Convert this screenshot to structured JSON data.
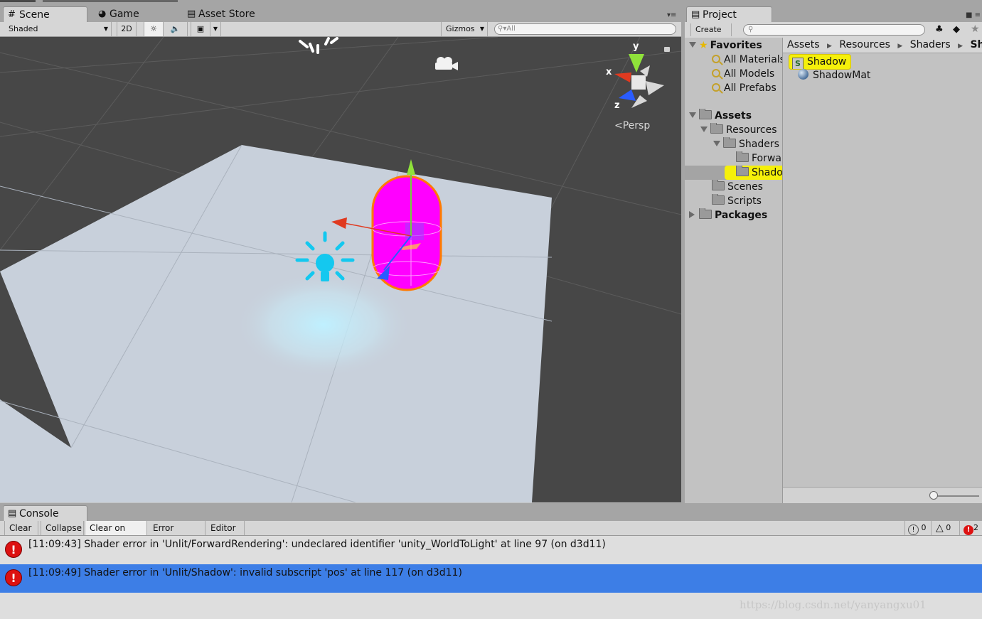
{
  "scene_panel": {
    "tabs": [
      {
        "label": "Scene",
        "icon": "grid-icon"
      },
      {
        "label": "Game",
        "icon": "pacman-icon"
      },
      {
        "label": "Asset Store",
        "icon": "store-icon"
      }
    ],
    "toolbar": {
      "shading_mode": "Shaded",
      "mode_2d": "2D",
      "gizmos": "Gizmos",
      "search_placeholder": "All"
    },
    "view": {
      "axis_labels": {
        "x": "x",
        "y": "y",
        "z": "z"
      },
      "projection": "Persp",
      "colors": {
        "background": "#474747",
        "plane": "#c8d0db",
        "capsule": "#ff00ff",
        "light": "#14c8ef"
      }
    }
  },
  "project_panel": {
    "tab": "Project",
    "create": "Create",
    "favorites": {
      "label": "Favorites",
      "items": [
        "All Materials",
        "All Models",
        "All Prefabs"
      ]
    },
    "assets": {
      "label": "Assets",
      "resources": "Resources",
      "shaders": "Shaders",
      "shader_children": [
        "Forwa",
        "Shado"
      ],
      "others": [
        "Scenes",
        "Scripts"
      ]
    },
    "packages": "Packages",
    "breadcrumb": [
      "Assets",
      "Resources",
      "Shaders",
      "Sha"
    ],
    "files": [
      {
        "name": "Shadow",
        "icon": "shader-icon",
        "selected": true
      },
      {
        "name": "ShadowMat",
        "icon": "material-sphere-icon",
        "selected": false
      }
    ]
  },
  "console": {
    "tab": "Console",
    "buttons": [
      "Clear",
      "Collapse",
      "Clear on Play",
      "Error Pause",
      "Editor"
    ],
    "counts": {
      "info": "0",
      "warn": "0",
      "error": "2"
    },
    "entries": [
      {
        "text": "[11:09:43] Shader error in 'Unlit/ForwardRendering': undeclared identifier 'unity_WorldToLight' at line 97 (on d3d11)",
        "selected": false
      },
      {
        "text": "[11:09:49] Shader error in 'Unlit/Shadow': invalid subscript 'pos' at line 117 (on d3d11)",
        "selected": true
      }
    ],
    "colors": {
      "selected_row": "#3d7ee6",
      "error": "#d11111"
    }
  },
  "watermark": "https://blog.csdn.net/yanyangxu01"
}
